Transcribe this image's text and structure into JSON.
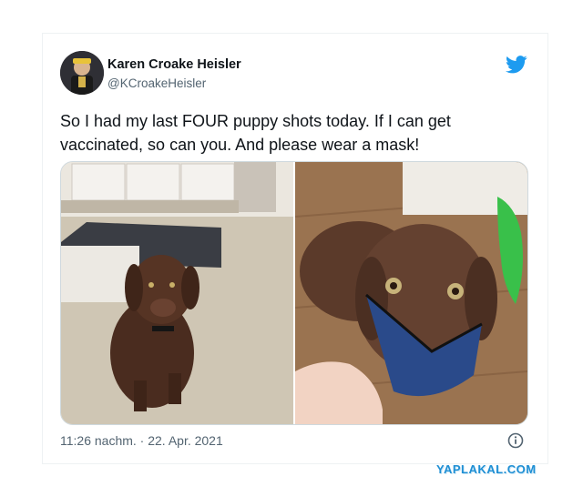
{
  "tweet": {
    "author_name": "Karen Croake Heisler",
    "author_handle": "@KCroakeHeisler",
    "text": "So I had my last FOUR puppy shots today. If I can get vaccinated, so can you. And please wear a mask!",
    "timestamp": "11:26 nachm. · 22. Apr. 2021"
  },
  "watermark": "YAPLAKAL.COM",
  "icons": {
    "brand": "twitter-bird-icon",
    "info": "info-circle-icon"
  },
  "colors": {
    "twitter_blue": "#1d9bf0",
    "text_primary": "#0f1419",
    "text_secondary": "#536471",
    "watermark_blue": "#1f8fd4"
  }
}
